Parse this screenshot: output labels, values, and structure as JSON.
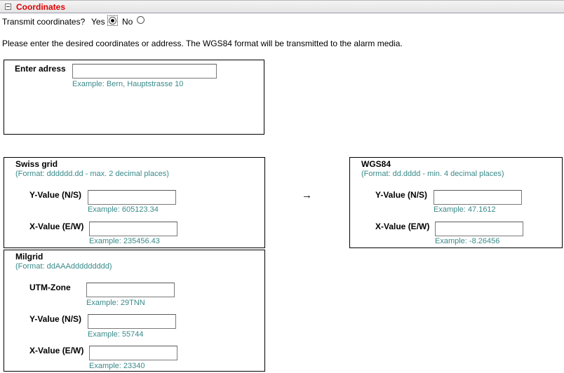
{
  "header": {
    "title": "Coordinates"
  },
  "transmit": {
    "label": "Transmit coordinates?",
    "yes_label": "Yes",
    "no_label": "No",
    "selected": "yes"
  },
  "instructions": "Please enter the desired coordinates or address. The WGS84 format will be transmitted to the alarm media.",
  "address": {
    "title": "Enter adress",
    "value": "",
    "example": "Example: Bern, Hauptstrasse 10"
  },
  "swiss_grid": {
    "title": "Swiss grid",
    "format": "(Format: dddddd.dd - max. 2 decimal places)",
    "y_label": "Y-Value (N/S)",
    "y_value": "",
    "y_example": "Example: 605123.34",
    "x_label": "X-Value (E/W)",
    "x_value": "",
    "x_example": "Example: 235456.43"
  },
  "arrow": "→",
  "wgs84": {
    "title": "WGS84",
    "format": "(Format: dd.dddd - min. 4 decimal places)",
    "y_label": "Y-Value (N/S)",
    "y_value": "",
    "y_example": "Example: 47.1612",
    "x_label": "X-Value (E/W)",
    "x_value": "",
    "x_example": "Example: -8.26456"
  },
  "milgrid": {
    "title": "Milgrid",
    "format": "(Format: ddAAAddddddddd)",
    "zone_label": "UTM-Zone",
    "zone_value": "",
    "zone_example": "Example: 29TNN",
    "y_label": "Y-Value (N/S)",
    "y_value": "",
    "y_example": "Example: 55744",
    "x_label": "X-Value (E/W)",
    "x_value": "",
    "x_example": "Example: 23340"
  }
}
